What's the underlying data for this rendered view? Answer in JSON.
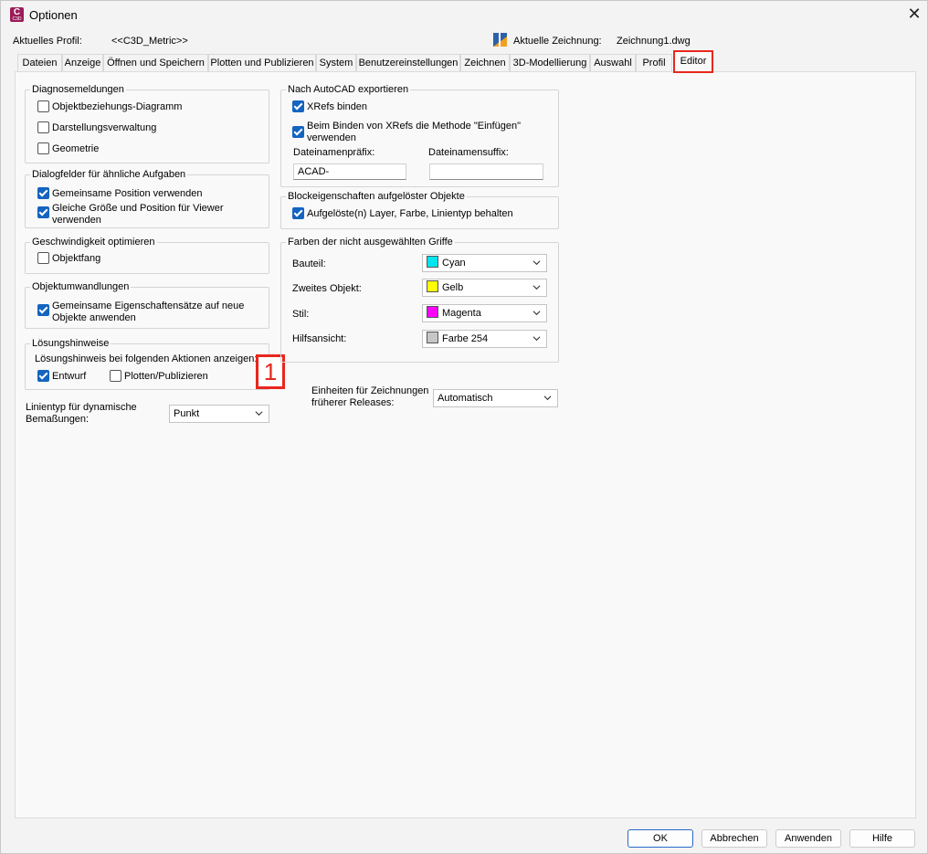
{
  "window": {
    "title": "Optionen",
    "app_icon_letter": "C",
    "app_icon_sub": "C3D"
  },
  "profile": {
    "current_profile_label": "Aktuelles Profil:",
    "current_profile_value": "<<C3D_Metric>>",
    "current_drawing_label": "Aktuelle Zeichnung:",
    "current_drawing_value": "Zeichnung1.dwg"
  },
  "tabs": [
    "Dateien",
    "Anzeige",
    "Öffnen und Speichern",
    "Plotten und Publizieren",
    "System",
    "Benutzereinstellungen",
    "Zeichnen",
    "3D-Modellierung",
    "Auswahl",
    "Profil",
    "Editor"
  ],
  "active_tab": "Editor",
  "left": {
    "diagnose": {
      "title": "Diagnosemeldungen",
      "items": [
        {
          "label": "Objektbeziehungs-Diagramm",
          "checked": false
        },
        {
          "label": "Darstellungsverwaltung",
          "checked": false
        },
        {
          "label": "Geometrie",
          "checked": false
        }
      ]
    },
    "dialogfelder": {
      "title": "Dialogfelder für ähnliche Aufgaben",
      "item1": "Gemeinsame Position verwenden",
      "item2_line1": "Gleiche Größe und Position für Viewer",
      "item2_line2": "verwenden"
    },
    "geschwindigkeit": {
      "title": "Geschwindigkeit optimieren",
      "item": "Objektfang"
    },
    "objektumwandlungen": {
      "title": "Objektumwandlungen",
      "item_line1": "Gemeinsame Eigenschaftensätze auf neue",
      "item_line2": "Objekte anwenden"
    },
    "loesungshinweise": {
      "title": "Lösungshinweise",
      "subtitle": "Lösungshinweis bei folgenden Aktionen anzeigen:",
      "entwurf": "Entwurf",
      "plotten": "Plotten/Publizieren"
    },
    "linientyp": {
      "label_line1": "Linientyp für dynamische",
      "label_line2": "Bemaßungen:",
      "value": "Punkt"
    }
  },
  "right": {
    "export": {
      "title": "Nach AutoCAD exportieren",
      "xrefs_binden": "XRefs binden",
      "binden_line1": "Beim Binden von XRefs die Methode \"Einfügen\"",
      "binden_line2": "verwenden",
      "prefix_label": "Dateinamenpräfix:",
      "prefix_value": "ACAD-",
      "suffix_label": "Dateinamensuffix:",
      "suffix_value": ""
    },
    "block": {
      "title": "Blockeigenschaften aufgelöster Objekte",
      "item": "Aufgelöste(n) Layer, Farbe, Linientyp behalten"
    },
    "griffe": {
      "title": "Farben der nicht ausgewählten Griffe",
      "rows": [
        {
          "label": "Bauteil:",
          "value": "Cyan",
          "color": "#00e5ee"
        },
        {
          "label": "Zweites Objekt:",
          "value": "Gelb",
          "color": "#ffff00"
        },
        {
          "label": "Stil:",
          "value": "Magenta",
          "color": "#ff00ff"
        },
        {
          "label": "Hilfsansicht:",
          "value": "Farbe 254",
          "color": "#c6c6c6"
        }
      ]
    },
    "einheiten": {
      "label_line1": "Einheiten für Zeichnungen",
      "label_line2": "früherer Releases:",
      "value": "Automatisch"
    }
  },
  "buttons": {
    "ok": "OK",
    "cancel": "Abbrechen",
    "apply": "Anwenden",
    "help": "Hilfe"
  },
  "annotation_marker": "1",
  "colors": {
    "accent": "#1464c0",
    "highlight": "#e8271d"
  }
}
